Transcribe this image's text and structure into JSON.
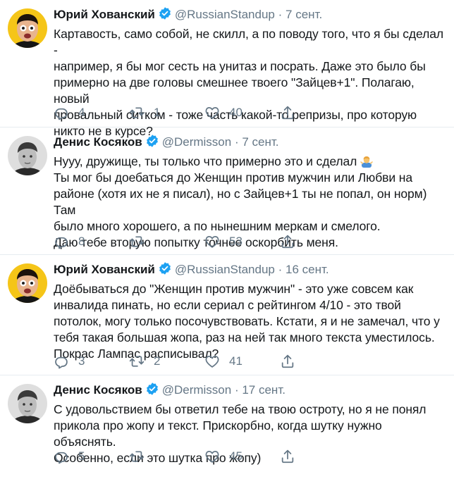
{
  "tweets": [
    {
      "name": "Юрий Хованский",
      "handle": "@RussianStandup",
      "separator": "·",
      "date": "7 сент.",
      "lines": [
        "Картавость, само собой, не скилл, а по поводу того, что я бы сделал -",
        "например, я бы мог сесть на унитаз и посрать. Даже это было бы",
        "примерно на две головы смешнее твоего \"Зайцев+1\". Полагаю, новый",
        "провальный ситком - тоже часть какой-то репризы, про которую",
        "никто не в курсе?"
      ],
      "replies": "4",
      "retweets": "1",
      "likes": "40"
    },
    {
      "name": "Денис Косяков",
      "handle": "@Dermisson",
      "separator": "·",
      "date": "7 сент.",
      "lines": [
        "Нууу, дружище, ты только что примерно это и сделал",
        "Ты мог бы доебаться до Женщин против мужчин или Любви на",
        "районе (хотя их не я писал), но с Зайцев+1 ты не попал, он норм) Там",
        "было много хорошего, а по нынешним меркам и смелого.",
        "Даю тебе вторую попытку точнее оскорбить меня."
      ],
      "emoji": "person-shrugging-emoji",
      "replies": "8",
      "retweets": "",
      "likes": "53"
    },
    {
      "name": "Юрий Хованский",
      "handle": "@RussianStandup",
      "separator": "·",
      "date": "16 сент.",
      "lines": [
        "Доёбываться до \"Женщин против мужчин\" - это уже совсем как",
        "инвалида пинать, но если сериал с рейтингом 4/10 - это твой",
        "потолок, могу только посочувствовать. Кстати, я и не замечал, что у",
        "тебя такая большая жопа, раз на ней так много текста уместилось.",
        "Покрас Лампас расписывал?"
      ],
      "replies": "3",
      "retweets": "2",
      "likes": "41"
    },
    {
      "name": "Денис Косяков",
      "handle": "@Dermisson",
      "separator": "·",
      "date": "17 сент.",
      "lines": [
        "С удовольствием бы ответил тебе на твою остроту, но я не понял",
        "прикола про жопу и текст. Прискорбно, когда шутку нужно объяснять.",
        "Особенно, если это шутка про жопу)"
      ],
      "replies": "5",
      "retweets": "",
      "likes": "45"
    }
  ],
  "colors": {
    "text": "#14171a",
    "secondary": "#657786",
    "verified": "#1da1f2",
    "divider": "#e6ecf0",
    "avatar_yellow": "#f5c518"
  },
  "icons": [
    "reply-icon",
    "retweet-icon",
    "like-icon",
    "share-icon",
    "verified-badge-icon"
  ]
}
